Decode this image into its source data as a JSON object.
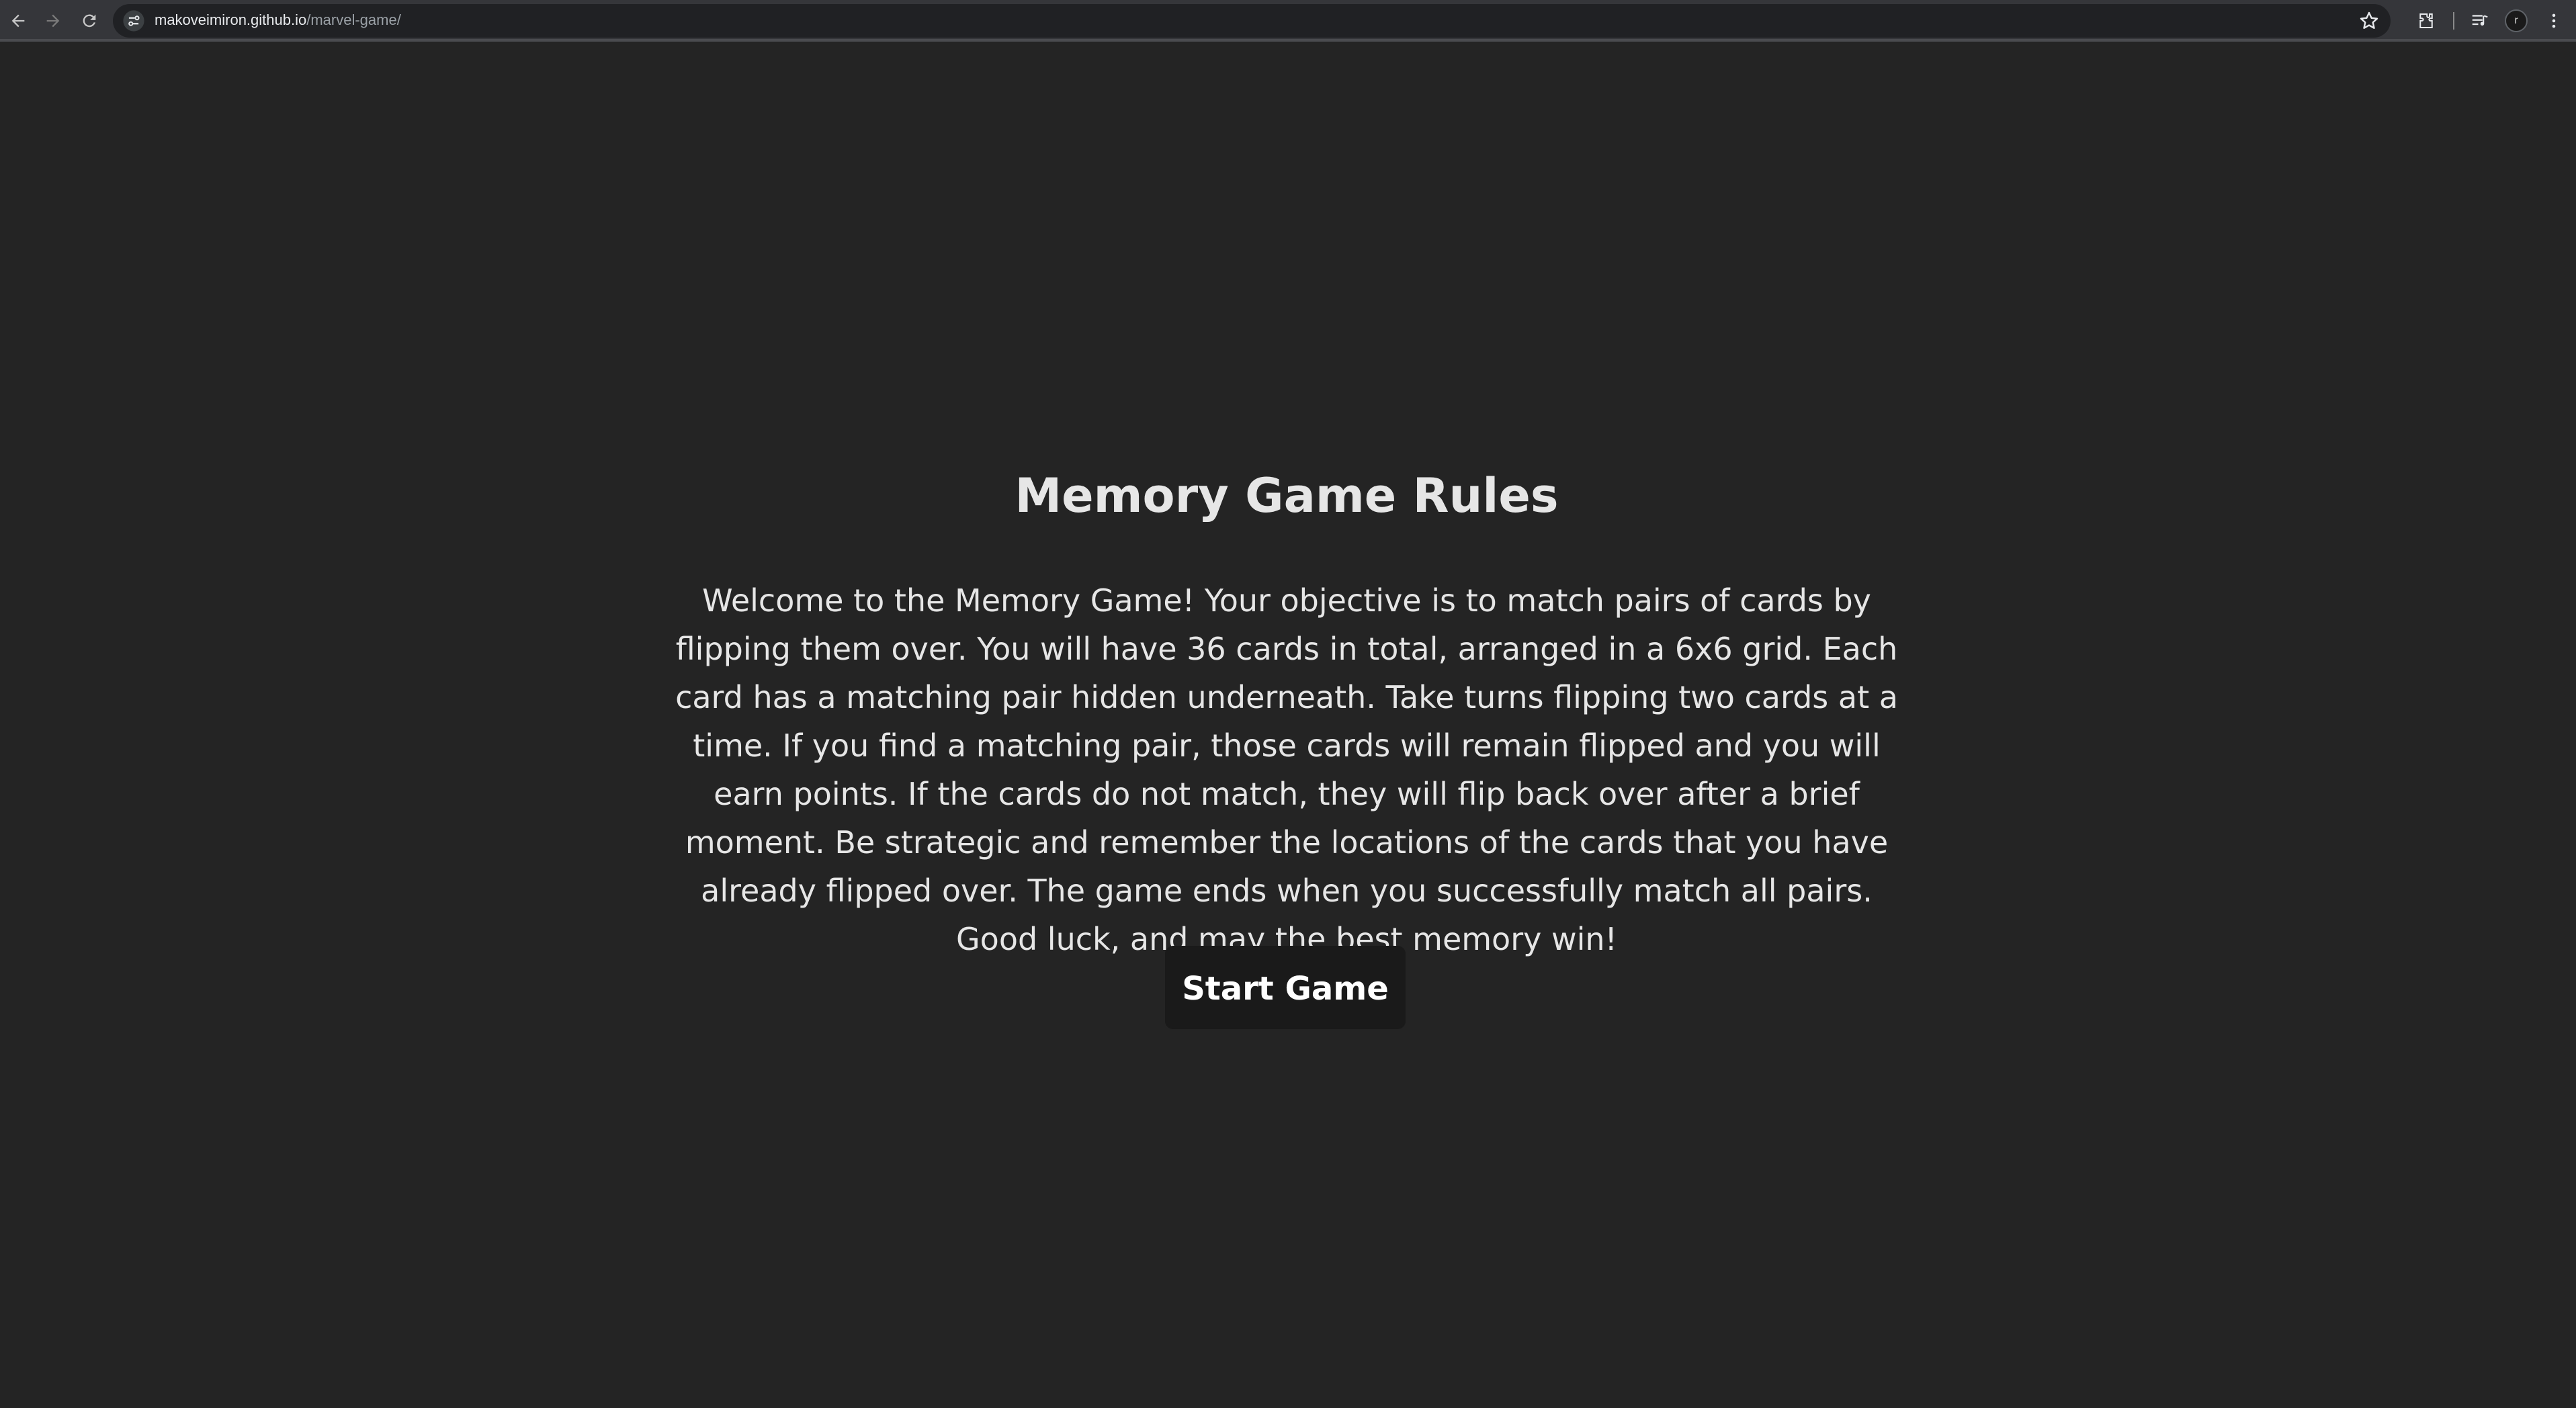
{
  "browser": {
    "url_host": "makoveimiron.github.io",
    "url_path": "/marvel-game/",
    "avatar_letter": "r",
    "icons": [
      "back-icon",
      "forward-icon",
      "reload-icon",
      "site-info-icon",
      "star-icon",
      "extensions-icon",
      "media-icon",
      "profile-avatar",
      "menu-icon"
    ]
  },
  "page": {
    "title": "Memory Game Rules",
    "rules_text": "Welcome to the Memory Game! Your objective is to match pairs of cards by flipping them over. You will have 36 cards in total, arranged in a 6x6 grid. Each card has a matching pair hidden underneath. Take turns flipping two cards at a time. If you find a matching pair, those cards will remain flipped and you will earn points. If the cards do not match, they will flip back over after a brief moment. Be strategic and remember the locations of the cards that you have already flipped over. The game ends when you successfully match all pairs. Good luck, and may the best memory win!",
    "start_button_label": "Start Game"
  },
  "colors": {
    "page_background": "#242424",
    "text": "#e6e6e6",
    "button_background": "#1a1a1a",
    "toolbar_background": "#35363a"
  }
}
